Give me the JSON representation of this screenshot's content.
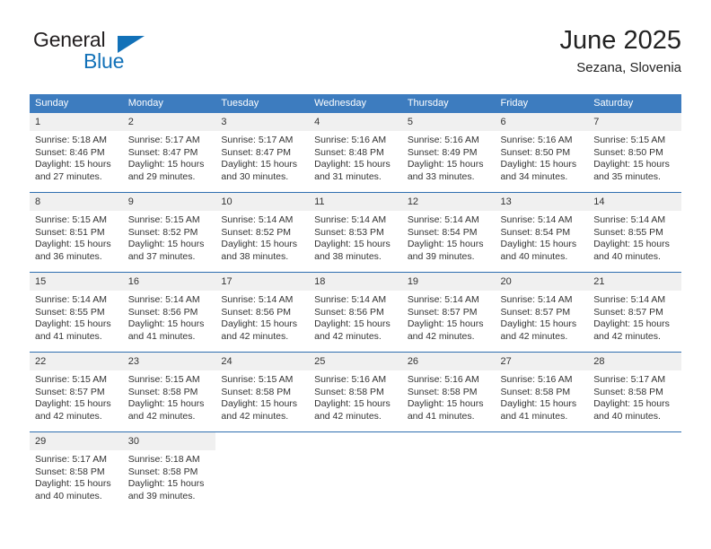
{
  "logo": {
    "text_primary": "General",
    "text_secondary": "Blue",
    "triangle_color": "#1271b8"
  },
  "header": {
    "title": "June 2025",
    "subtitle": "Sezana, Slovenia"
  },
  "theme": {
    "header_row_bg": "#3d7cbf",
    "week_divider": "#2f6fb0",
    "daynum_bg": "#f0f0f0"
  },
  "calendar": {
    "weekday_headers": [
      "Sunday",
      "Monday",
      "Tuesday",
      "Wednesday",
      "Thursday",
      "Friday",
      "Saturday"
    ],
    "weeks": [
      [
        {
          "day": "1",
          "sunrise": "Sunrise: 5:18 AM",
          "sunset": "Sunset: 8:46 PM",
          "daylight_line1": "Daylight: 15 hours",
          "daylight_line2": "and 27 minutes."
        },
        {
          "day": "2",
          "sunrise": "Sunrise: 5:17 AM",
          "sunset": "Sunset: 8:47 PM",
          "daylight_line1": "Daylight: 15 hours",
          "daylight_line2": "and 29 minutes."
        },
        {
          "day": "3",
          "sunrise": "Sunrise: 5:17 AM",
          "sunset": "Sunset: 8:47 PM",
          "daylight_line1": "Daylight: 15 hours",
          "daylight_line2": "and 30 minutes."
        },
        {
          "day": "4",
          "sunrise": "Sunrise: 5:16 AM",
          "sunset": "Sunset: 8:48 PM",
          "daylight_line1": "Daylight: 15 hours",
          "daylight_line2": "and 31 minutes."
        },
        {
          "day": "5",
          "sunrise": "Sunrise: 5:16 AM",
          "sunset": "Sunset: 8:49 PM",
          "daylight_line1": "Daylight: 15 hours",
          "daylight_line2": "and 33 minutes."
        },
        {
          "day": "6",
          "sunrise": "Sunrise: 5:16 AM",
          "sunset": "Sunset: 8:50 PM",
          "daylight_line1": "Daylight: 15 hours",
          "daylight_line2": "and 34 minutes."
        },
        {
          "day": "7",
          "sunrise": "Sunrise: 5:15 AM",
          "sunset": "Sunset: 8:50 PM",
          "daylight_line1": "Daylight: 15 hours",
          "daylight_line2": "and 35 minutes."
        }
      ],
      [
        {
          "day": "8",
          "sunrise": "Sunrise: 5:15 AM",
          "sunset": "Sunset: 8:51 PM",
          "daylight_line1": "Daylight: 15 hours",
          "daylight_line2": "and 36 minutes."
        },
        {
          "day": "9",
          "sunrise": "Sunrise: 5:15 AM",
          "sunset": "Sunset: 8:52 PM",
          "daylight_line1": "Daylight: 15 hours",
          "daylight_line2": "and 37 minutes."
        },
        {
          "day": "10",
          "sunrise": "Sunrise: 5:14 AM",
          "sunset": "Sunset: 8:52 PM",
          "daylight_line1": "Daylight: 15 hours",
          "daylight_line2": "and 38 minutes."
        },
        {
          "day": "11",
          "sunrise": "Sunrise: 5:14 AM",
          "sunset": "Sunset: 8:53 PM",
          "daylight_line1": "Daylight: 15 hours",
          "daylight_line2": "and 38 minutes."
        },
        {
          "day": "12",
          "sunrise": "Sunrise: 5:14 AM",
          "sunset": "Sunset: 8:54 PM",
          "daylight_line1": "Daylight: 15 hours",
          "daylight_line2": "and 39 minutes."
        },
        {
          "day": "13",
          "sunrise": "Sunrise: 5:14 AM",
          "sunset": "Sunset: 8:54 PM",
          "daylight_line1": "Daylight: 15 hours",
          "daylight_line2": "and 40 minutes."
        },
        {
          "day": "14",
          "sunrise": "Sunrise: 5:14 AM",
          "sunset": "Sunset: 8:55 PM",
          "daylight_line1": "Daylight: 15 hours",
          "daylight_line2": "and 40 minutes."
        }
      ],
      [
        {
          "day": "15",
          "sunrise": "Sunrise: 5:14 AM",
          "sunset": "Sunset: 8:55 PM",
          "daylight_line1": "Daylight: 15 hours",
          "daylight_line2": "and 41 minutes."
        },
        {
          "day": "16",
          "sunrise": "Sunrise: 5:14 AM",
          "sunset": "Sunset: 8:56 PM",
          "daylight_line1": "Daylight: 15 hours",
          "daylight_line2": "and 41 minutes."
        },
        {
          "day": "17",
          "sunrise": "Sunrise: 5:14 AM",
          "sunset": "Sunset: 8:56 PM",
          "daylight_line1": "Daylight: 15 hours",
          "daylight_line2": "and 42 minutes."
        },
        {
          "day": "18",
          "sunrise": "Sunrise: 5:14 AM",
          "sunset": "Sunset: 8:56 PM",
          "daylight_line1": "Daylight: 15 hours",
          "daylight_line2": "and 42 minutes."
        },
        {
          "day": "19",
          "sunrise": "Sunrise: 5:14 AM",
          "sunset": "Sunset: 8:57 PM",
          "daylight_line1": "Daylight: 15 hours",
          "daylight_line2": "and 42 minutes."
        },
        {
          "day": "20",
          "sunrise": "Sunrise: 5:14 AM",
          "sunset": "Sunset: 8:57 PM",
          "daylight_line1": "Daylight: 15 hours",
          "daylight_line2": "and 42 minutes."
        },
        {
          "day": "21",
          "sunrise": "Sunrise: 5:14 AM",
          "sunset": "Sunset: 8:57 PM",
          "daylight_line1": "Daylight: 15 hours",
          "daylight_line2": "and 42 minutes."
        }
      ],
      [
        {
          "day": "22",
          "sunrise": "Sunrise: 5:15 AM",
          "sunset": "Sunset: 8:57 PM",
          "daylight_line1": "Daylight: 15 hours",
          "daylight_line2": "and 42 minutes."
        },
        {
          "day": "23",
          "sunrise": "Sunrise: 5:15 AM",
          "sunset": "Sunset: 8:58 PM",
          "daylight_line1": "Daylight: 15 hours",
          "daylight_line2": "and 42 minutes."
        },
        {
          "day": "24",
          "sunrise": "Sunrise: 5:15 AM",
          "sunset": "Sunset: 8:58 PM",
          "daylight_line1": "Daylight: 15 hours",
          "daylight_line2": "and 42 minutes."
        },
        {
          "day": "25",
          "sunrise": "Sunrise: 5:16 AM",
          "sunset": "Sunset: 8:58 PM",
          "daylight_line1": "Daylight: 15 hours",
          "daylight_line2": "and 42 minutes."
        },
        {
          "day": "26",
          "sunrise": "Sunrise: 5:16 AM",
          "sunset": "Sunset: 8:58 PM",
          "daylight_line1": "Daylight: 15 hours",
          "daylight_line2": "and 41 minutes."
        },
        {
          "day": "27",
          "sunrise": "Sunrise: 5:16 AM",
          "sunset": "Sunset: 8:58 PM",
          "daylight_line1": "Daylight: 15 hours",
          "daylight_line2": "and 41 minutes."
        },
        {
          "day": "28",
          "sunrise": "Sunrise: 5:17 AM",
          "sunset": "Sunset: 8:58 PM",
          "daylight_line1": "Daylight: 15 hours",
          "daylight_line2": "and 40 minutes."
        }
      ],
      [
        {
          "day": "29",
          "sunrise": "Sunrise: 5:17 AM",
          "sunset": "Sunset: 8:58 PM",
          "daylight_line1": "Daylight: 15 hours",
          "daylight_line2": "and 40 minutes."
        },
        {
          "day": "30",
          "sunrise": "Sunrise: 5:18 AM",
          "sunset": "Sunset: 8:58 PM",
          "daylight_line1": "Daylight: 15 hours",
          "daylight_line2": "and 39 minutes."
        },
        {
          "day": "",
          "sunrise": "",
          "sunset": "",
          "daylight_line1": "",
          "daylight_line2": ""
        },
        {
          "day": "",
          "sunrise": "",
          "sunset": "",
          "daylight_line1": "",
          "daylight_line2": ""
        },
        {
          "day": "",
          "sunrise": "",
          "sunset": "",
          "daylight_line1": "",
          "daylight_line2": ""
        },
        {
          "day": "",
          "sunrise": "",
          "sunset": "",
          "daylight_line1": "",
          "daylight_line2": ""
        },
        {
          "day": "",
          "sunrise": "",
          "sunset": "",
          "daylight_line1": "",
          "daylight_line2": ""
        }
      ]
    ]
  }
}
